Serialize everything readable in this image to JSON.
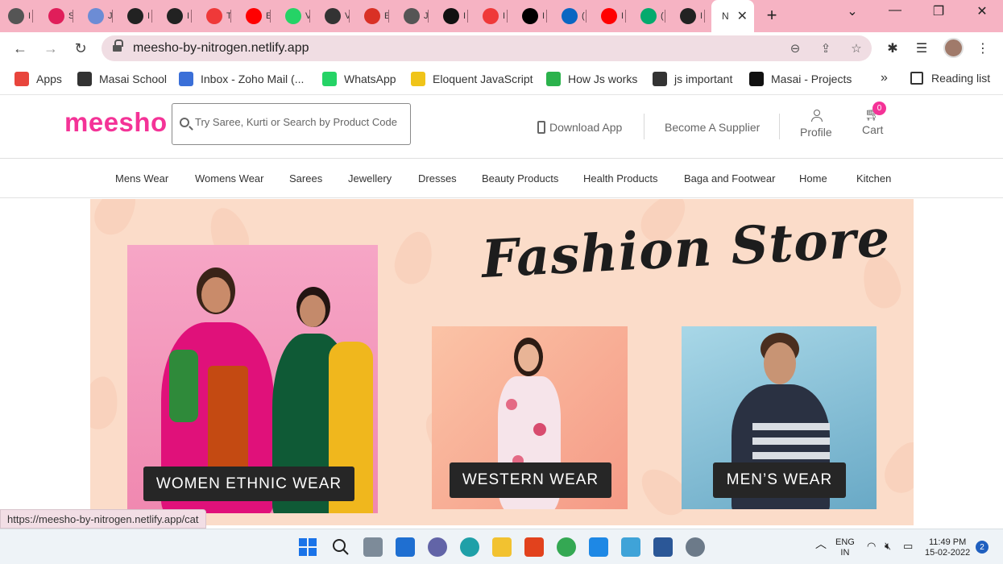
{
  "browser": {
    "tabs": [
      {
        "label": "I",
        "icon": "globe-icon",
        "color": "#555555"
      },
      {
        "label": "S",
        "icon": "slack-icon",
        "color": "#e01e5a"
      },
      {
        "label": "J",
        "icon": "cloud-icon",
        "color": "#6c8cd5"
      },
      {
        "label": "I",
        "icon": "cube-icon",
        "color": "#222222"
      },
      {
        "label": "I",
        "icon": "github-icon",
        "color": "#222222"
      },
      {
        "label": "T",
        "icon": "vivaldi-icon",
        "color": "#ef3939"
      },
      {
        "label": "E",
        "icon": "youtube-icon",
        "color": "#ff0000"
      },
      {
        "label": "V",
        "icon": "whatsapp-icon",
        "color": "#25d366"
      },
      {
        "label": "V",
        "icon": "code-icon",
        "color": "#333333"
      },
      {
        "label": "E",
        "icon": "gmail-icon",
        "color": "#d93025"
      },
      {
        "label": "J",
        "icon": "globe-icon",
        "color": "#555555"
      },
      {
        "label": "I",
        "icon": "react-icon",
        "color": "#111111"
      },
      {
        "label": "I",
        "icon": "vivaldi-icon",
        "color": "#ef3939"
      },
      {
        "label": "I",
        "icon": "dev-icon",
        "color": "#000000"
      },
      {
        "label": "(",
        "icon": "linkedin-icon",
        "color": "#0a66c2"
      },
      {
        "label": "I",
        "icon": "youtube-icon",
        "color": "#ff0000"
      },
      {
        "label": "(",
        "icon": "w3-icon",
        "color": "#04aa6d"
      },
      {
        "label": "I",
        "icon": "github-icon",
        "color": "#222222"
      }
    ],
    "active_tab": {
      "label": "N"
    },
    "url": "meesho-by-nitrogen.netlify.app",
    "bookmarks": [
      {
        "label": "Apps",
        "icon": "apps-grid-icon",
        "color": "#e8453c"
      },
      {
        "label": "Masai School",
        "icon": "globe-icon",
        "color": "#333333"
      },
      {
        "label": "Inbox - Zoho Mail (...",
        "icon": "zoho-mail-icon",
        "color": "#3a6fd8"
      },
      {
        "label": "WhatsApp",
        "icon": "whatsapp-icon",
        "color": "#25d366"
      },
      {
        "label": "Eloquent JavaScript",
        "icon": "ejs-icon",
        "color": "#f0c419"
      },
      {
        "label": "How Js works",
        "icon": "scrimba-icon",
        "color": "#2bb24c"
      },
      {
        "label": "js important",
        "icon": "globe-icon",
        "color": "#333333"
      },
      {
        "label": "Masai - Projects",
        "icon": "notion-icon",
        "color": "#111111"
      }
    ],
    "reading_list": "Reading list",
    "status_url": "https://meesho-by-nitrogen.netlify.app/cat"
  },
  "site": {
    "logo": "meesho",
    "brand_color": "#f43397",
    "search_placeholder": "Try Saree, Kurti or Search by Product Code",
    "download_app": "Download App",
    "become_supplier": "Become A Supplier",
    "profile": "Profile",
    "cart": "Cart",
    "cart_count": "0",
    "categories": [
      "Mens Wear",
      "Womens Wear",
      "Sarees",
      "Jewellery",
      "Dresses",
      "Beauty Products",
      "Health Products",
      "Baga and Footwear",
      "Home",
      "Kitchen"
    ],
    "hero": {
      "title": "Fashion Store",
      "cards": [
        {
          "label": "WOMEN ETHNIC WEAR"
        },
        {
          "label": "WESTERN WEAR"
        },
        {
          "label": "MEN’S WEAR"
        }
      ]
    }
  },
  "taskbar": {
    "lang_top": "ENG",
    "lang_bottom": "IN",
    "time": "11:49 PM",
    "date": "15-02-2022",
    "notifications": "2"
  }
}
